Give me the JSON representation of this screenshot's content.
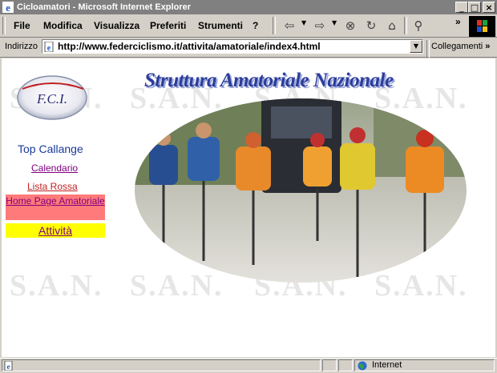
{
  "window": {
    "title": "Cicloamatori - Microsoft Internet Explorer",
    "min_glyph": "_",
    "max_glyph": "□",
    "close_glyph": "×"
  },
  "menu": [
    {
      "label": "File"
    },
    {
      "label": "Modifica"
    },
    {
      "label": "Visualizza"
    },
    {
      "label": "Preferiti"
    },
    {
      "label": "Strumenti"
    },
    {
      "label": "?"
    }
  ],
  "toolbar": {
    "back_icon": "⇦",
    "forward_icon": "⇨",
    "stop_icon": "⊗",
    "refresh_icon": "↻",
    "home_icon": "⌂",
    "search_icon": "⚲",
    "more_glyph": "»"
  },
  "address": {
    "label": "Indirizzo",
    "url": "http://www.federciclismo.it/attivita/amatoriale/index4.html",
    "links_label": "Collegamenti",
    "links_more": "»"
  },
  "page": {
    "logo_text": "F.C.I.",
    "banner": "Struttura Amatoriale Nazionale",
    "watermark": "S.A.N.",
    "top_title": "Top Callange",
    "nav": [
      {
        "label": "Calendario"
      },
      {
        "label": "Lista Rossa"
      },
      {
        "label": "Home Page Amatoriale"
      },
      {
        "label": "Attività"
      }
    ],
    "colors": {
      "home_bg": "#ff7a7a",
      "attivita_bg": "#ffff00",
      "link": "#800080"
    }
  },
  "status": {
    "zone": "Internet"
  }
}
